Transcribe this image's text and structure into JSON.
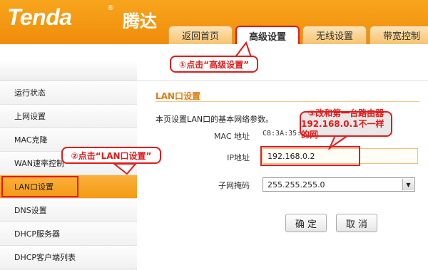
{
  "header": {
    "logo_text": "Tenda",
    "logo_cn": "腾达",
    "tabs": [
      {
        "label": "返回首页"
      },
      {
        "label": "高级设置"
      },
      {
        "label": "无线设置"
      },
      {
        "label": "带宽控制"
      }
    ]
  },
  "sidebar": {
    "items": [
      {
        "label": "运行状态"
      },
      {
        "label": "上网设置"
      },
      {
        "label": "MAC克隆"
      },
      {
        "label": "WAN速率控制"
      },
      {
        "label": "LAN口设置"
      },
      {
        "label": "DNS设置"
      },
      {
        "label": "DHCP服务器"
      },
      {
        "label": "DHCP客户端列表"
      }
    ]
  },
  "main": {
    "section_title": "LAN口设置",
    "description": "本页设置LAN口的基本网络参数。",
    "mac_label": "MAC 地址",
    "mac_value": "C8:3A:35:2",
    "ip_label": "IP地址",
    "ip_value": "192.168.0.2",
    "mask_label": "子网掩码",
    "mask_value": "255.255.255.0",
    "confirm_label": "确 定",
    "cancel_label": "取 消"
  },
  "annotations": {
    "step1": "①点击“高级设置”",
    "step2": "②点击“LAN口设置”",
    "step3_line1": "③改和第一台路由器",
    "step3_line2": "192.168.0.1不一样的网"
  },
  "colors": {
    "accent_orange": "#f39a16",
    "annotation_red": "#e21a1a",
    "title_orange": "#e07a10"
  }
}
